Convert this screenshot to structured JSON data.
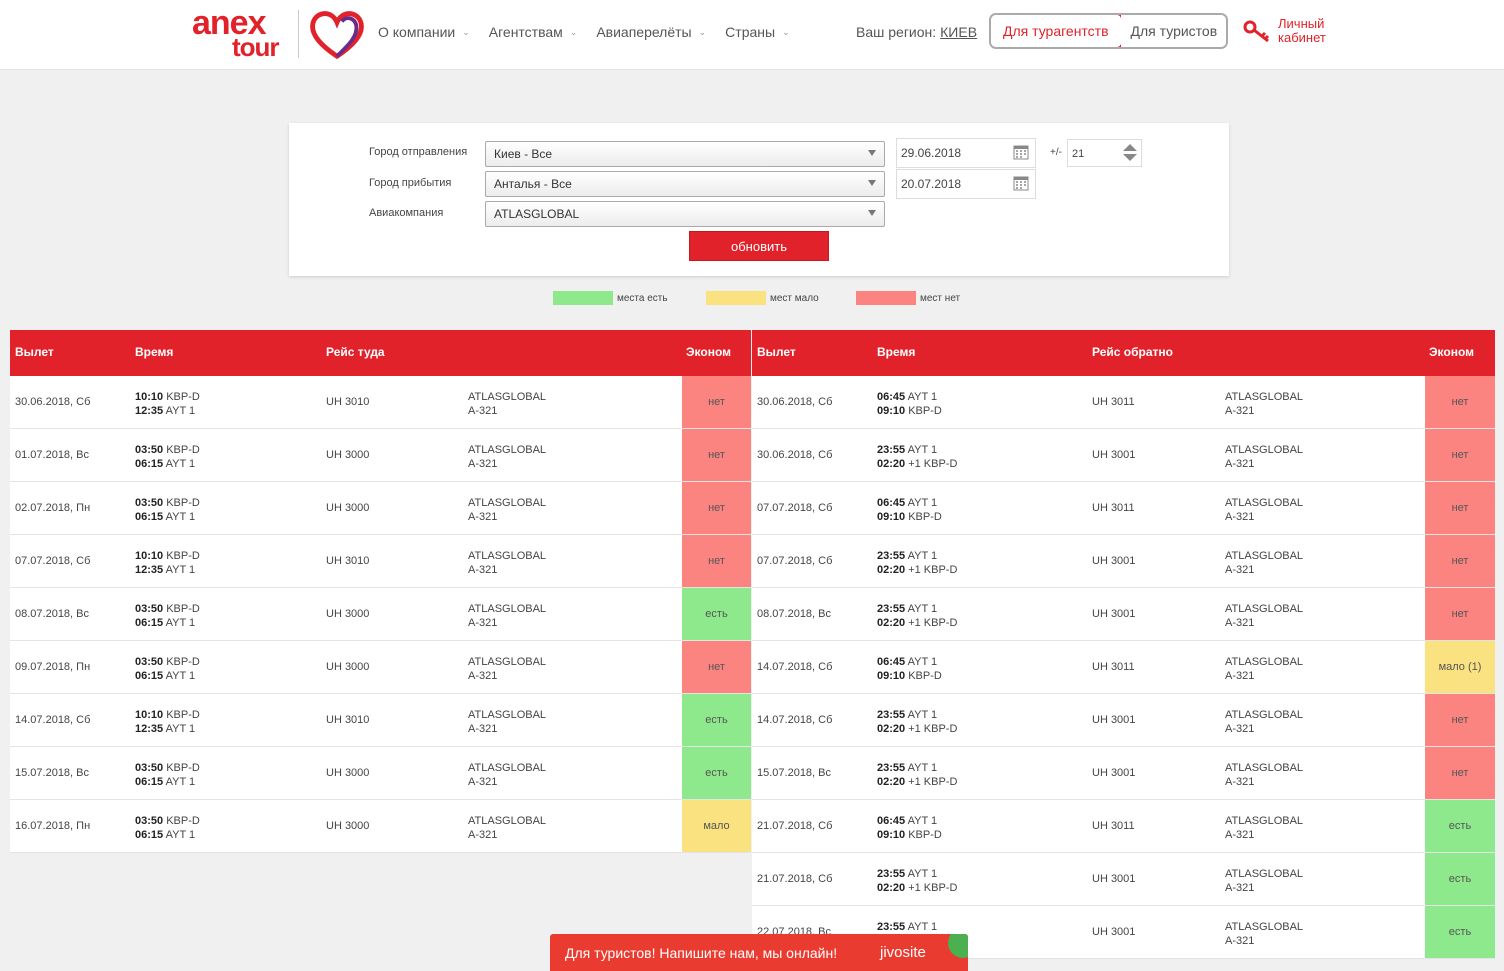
{
  "header": {
    "logo": {
      "word1": "anex",
      "word2": "tour"
    },
    "nav": [
      {
        "label": "О компании"
      },
      {
        "label": "Агентствам"
      },
      {
        "label": "Авиаперелёты"
      },
      {
        "label": "Страны"
      }
    ],
    "region_label": "Ваш регион:",
    "region_value": "КИЕВ",
    "btn_agents": "Для турагентств",
    "btn_tourists": "Для туристов",
    "cabinet_line1": "Личный",
    "cabinet_line2": "кабинет"
  },
  "filter": {
    "departure_label": "Город отправления",
    "departure_value": "Киев - Все",
    "arrival_label": "Город прибытия",
    "arrival_value": "Анталья - Все",
    "airline_label": "Авиакомпания",
    "airline_value": "ATLASGLOBAL",
    "date_from": "29.06.2018",
    "date_to": "20.07.2018",
    "pm_label": "+/-",
    "range_value": "21",
    "update_button": "обновить"
  },
  "legend": [
    {
      "label": "места есть",
      "color": "#8de98b"
    },
    {
      "label": "мест мало",
      "color": "#fbe280"
    },
    {
      "label": "мест нет",
      "color": "#fb8481"
    }
  ],
  "outbound": {
    "headers": {
      "dep": "Вылет",
      "time": "Время",
      "flight": "Рейс туда",
      "econ": "Эконом"
    },
    "rows": [
      {
        "date": "30.06.2018, Сб",
        "t1": "10:10",
        "p1": "KBP-D",
        "t2": "12:35",
        "p2": "AYT 1",
        "flight": "UH 3010",
        "airline": "ATLASGLOBAL",
        "plane": "A-321",
        "econ": "нет",
        "status": "red"
      },
      {
        "date": "01.07.2018, Вс",
        "t1": "03:50",
        "p1": "KBP-D",
        "t2": "06:15",
        "p2": "AYT 1",
        "flight": "UH 3000",
        "airline": "ATLASGLOBAL",
        "plane": "A-321",
        "econ": "нет",
        "status": "red"
      },
      {
        "date": "02.07.2018, Пн",
        "t1": "03:50",
        "p1": "KBP-D",
        "t2": "06:15",
        "p2": "AYT 1",
        "flight": "UH 3000",
        "airline": "ATLASGLOBAL",
        "plane": "A-321",
        "econ": "нет",
        "status": "red"
      },
      {
        "date": "07.07.2018, Сб",
        "t1": "10:10",
        "p1": "KBP-D",
        "t2": "12:35",
        "p2": "AYT 1",
        "flight": "UH 3010",
        "airline": "ATLASGLOBAL",
        "plane": "A-321",
        "econ": "нет",
        "status": "red"
      },
      {
        "date": "08.07.2018, Вс",
        "t1": "03:50",
        "p1": "KBP-D",
        "t2": "06:15",
        "p2": "AYT 1",
        "flight": "UH 3000",
        "airline": "ATLASGLOBAL",
        "plane": "A-321",
        "econ": "есть",
        "status": "green"
      },
      {
        "date": "09.07.2018, Пн",
        "t1": "03:50",
        "p1": "KBP-D",
        "t2": "06:15",
        "p2": "AYT 1",
        "flight": "UH 3000",
        "airline": "ATLASGLOBAL",
        "plane": "A-321",
        "econ": "нет",
        "status": "red"
      },
      {
        "date": "14.07.2018, Сб",
        "t1": "10:10",
        "p1": "KBP-D",
        "t2": "12:35",
        "p2": "AYT 1",
        "flight": "UH 3010",
        "airline": "ATLASGLOBAL",
        "plane": "A-321",
        "econ": "есть",
        "status": "green"
      },
      {
        "date": "15.07.2018, Вс",
        "t1": "03:50",
        "p1": "KBP-D",
        "t2": "06:15",
        "p2": "AYT 1",
        "flight": "UH 3000",
        "airline": "ATLASGLOBAL",
        "plane": "A-321",
        "econ": "есть",
        "status": "green"
      },
      {
        "date": "16.07.2018, Пн",
        "t1": "03:50",
        "p1": "KBP-D",
        "t2": "06:15",
        "p2": "AYT 1",
        "flight": "UH 3000",
        "airline": "ATLASGLOBAL",
        "plane": "A-321",
        "econ": "мало",
        "status": "yellow"
      }
    ]
  },
  "return": {
    "headers": {
      "dep": "Вылет",
      "time": "Время",
      "flight": "Рейс обратно",
      "econ": "Эконом"
    },
    "rows": [
      {
        "date": "30.06.2018, Сб",
        "t1": "06:45",
        "p1": "AYT 1",
        "t2": "09:10",
        "p2": "KBP-D",
        "flight": "UH 3011",
        "airline": "ATLASGLOBAL",
        "plane": "A-321",
        "econ": "нет",
        "status": "red"
      },
      {
        "date": "30.06.2018, Сб",
        "t1": "23:55",
        "p1": "AYT 1",
        "t2": "02:20",
        "p2": "+1 KBP-D",
        "flight": "UH 3001",
        "airline": "ATLASGLOBAL",
        "plane": "A-321",
        "econ": "нет",
        "status": "red"
      },
      {
        "date": "07.07.2018, Сб",
        "t1": "06:45",
        "p1": "AYT 1",
        "t2": "09:10",
        "p2": "KBP-D",
        "flight": "UH 3011",
        "airline": "ATLASGLOBAL",
        "plane": "A-321",
        "econ": "нет",
        "status": "red"
      },
      {
        "date": "07.07.2018, Сб",
        "t1": "23:55",
        "p1": "AYT 1",
        "t2": "02:20",
        "p2": "+1 KBP-D",
        "flight": "UH 3001",
        "airline": "ATLASGLOBAL",
        "plane": "A-321",
        "econ": "нет",
        "status": "red"
      },
      {
        "date": "08.07.2018, Вс",
        "t1": "23:55",
        "p1": "AYT 1",
        "t2": "02:20",
        "p2": "+1 KBP-D",
        "flight": "UH 3001",
        "airline": "ATLASGLOBAL",
        "plane": "A-321",
        "econ": "нет",
        "status": "red"
      },
      {
        "date": "14.07.2018, Сб",
        "t1": "06:45",
        "p1": "AYT 1",
        "t2": "09:10",
        "p2": "KBP-D",
        "flight": "UH 3011",
        "airline": "ATLASGLOBAL",
        "plane": "A-321",
        "econ": "мало (1)",
        "status": "yellow"
      },
      {
        "date": "14.07.2018, Сб",
        "t1": "23:55",
        "p1": "AYT 1",
        "t2": "02:20",
        "p2": "+1 KBP-D",
        "flight": "UH 3001",
        "airline": "ATLASGLOBAL",
        "plane": "A-321",
        "econ": "нет",
        "status": "red"
      },
      {
        "date": "15.07.2018, Вс",
        "t1": "23:55",
        "p1": "AYT 1",
        "t2": "02:20",
        "p2": "+1 KBP-D",
        "flight": "UH 3001",
        "airline": "ATLASGLOBAL",
        "plane": "A-321",
        "econ": "нет",
        "status": "red"
      },
      {
        "date": "21.07.2018, Сб",
        "t1": "06:45",
        "p1": "AYT 1",
        "t2": "09:10",
        "p2": "KBP-D",
        "flight": "UH 3011",
        "airline": "ATLASGLOBAL",
        "plane": "A-321",
        "econ": "есть",
        "status": "green"
      },
      {
        "date": "21.07.2018, Сб",
        "t1": "23:55",
        "p1": "AYT 1",
        "t2": "02:20",
        "p2": "+1 KBP-D",
        "flight": "UH 3001",
        "airline": "ATLASGLOBAL",
        "plane": "A-321",
        "econ": "есть",
        "status": "green"
      },
      {
        "date": "22.07.2018, Вс",
        "t1": "23:55",
        "p1": "AYT 1",
        "t2": "",
        "p2": "",
        "flight": "UH 3001",
        "airline": "ATLASGLOBAL",
        "plane": "A-321",
        "econ": "есть",
        "status": "green"
      }
    ]
  },
  "chat": {
    "message": "Для туристов! Напишите нам, мы онлайн!",
    "brand": "jivosite"
  }
}
